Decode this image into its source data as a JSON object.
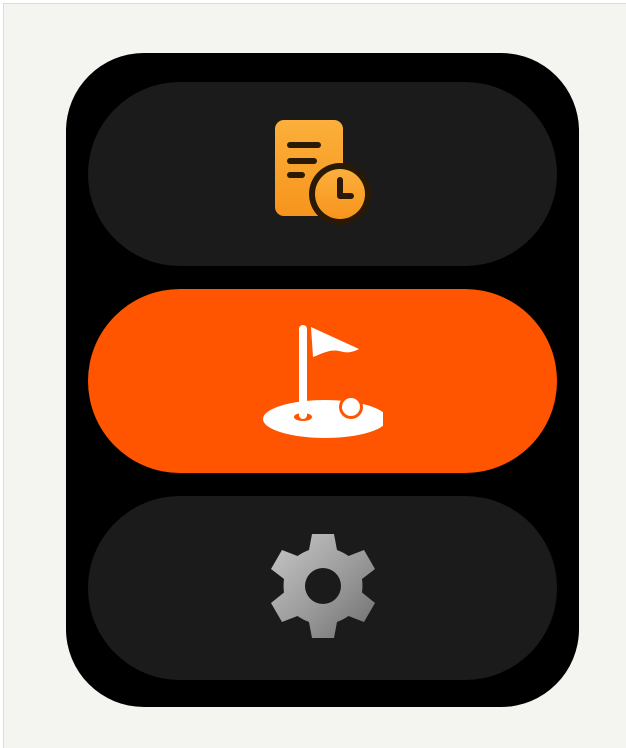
{
  "menu": {
    "items": [
      {
        "id": "history",
        "icon": "document-clock-icon",
        "active": false
      },
      {
        "id": "golf",
        "icon": "golf-flag-icon",
        "active": true
      },
      {
        "id": "settings",
        "icon": "gear-icon",
        "active": false
      }
    ]
  },
  "colors": {
    "screen_background": "#000000",
    "pill_inactive": "#1b1b1b",
    "pill_active": "#ff5500",
    "history_icon": "#f7a12b",
    "golf_icon": "#ffffff",
    "settings_icon": "#9a9a9a",
    "page_background": "#f4f4f0"
  }
}
